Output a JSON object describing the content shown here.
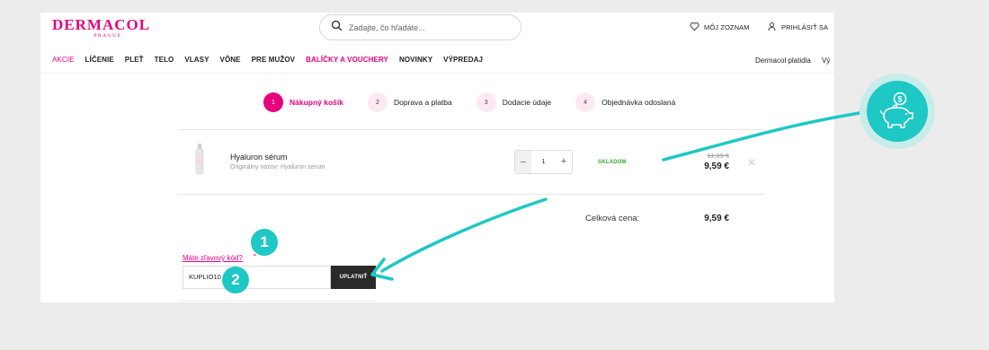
{
  "header": {
    "logo": {
      "main": "DERMACOL",
      "sub": "PRAGUE"
    },
    "search": {
      "placeholder": "Zadajte, čo hľadáte..."
    },
    "wishlist": "MÔJ ZOZNAM",
    "login": "PRIHLÁSIŤ SA"
  },
  "nav": {
    "items": [
      "AKCIE",
      "LÍČENIE",
      "PLEŤ",
      "TELO",
      "VLASY",
      "VÔNE",
      "PRE MUŽOV",
      "BALÍČKY A VOUCHERY",
      "NOVINKY",
      "VÝPREDAJ"
    ],
    "right": "Dermacol platidla",
    "right_cut": "Vý"
  },
  "steps": [
    {
      "num": "1",
      "label": "Nákupný košík"
    },
    {
      "num": "2",
      "label": "Doprava a platba"
    },
    {
      "num": "3",
      "label": "Dodacie údaje"
    },
    {
      "num": "4",
      "label": "Objednávka odoslaná"
    }
  ],
  "cart": {
    "item": {
      "name": "Hyaluron sérum",
      "original_name": "Originálny názov: Hyaluron serum",
      "quantity": "1",
      "minus": "−",
      "plus": "+",
      "stock": "SKLADOM",
      "old_price": "11,99 €",
      "price": "9,59 €",
      "remove": "✕"
    },
    "total_label": "Celková cena:",
    "total_value": "9,59 €"
  },
  "discount": {
    "link": "Máte zľavový kód?",
    "chevron": "⌃",
    "value": "KUPLIO10",
    "button": "UPLATNIŤ"
  },
  "annotations": {
    "badge1": "1",
    "badge2": "2",
    "accent_color": "#1ec8c4"
  },
  "colors": {
    "brand": "#e6007e",
    "stock": "#3aa53a",
    "button": "#2a2a2a"
  }
}
